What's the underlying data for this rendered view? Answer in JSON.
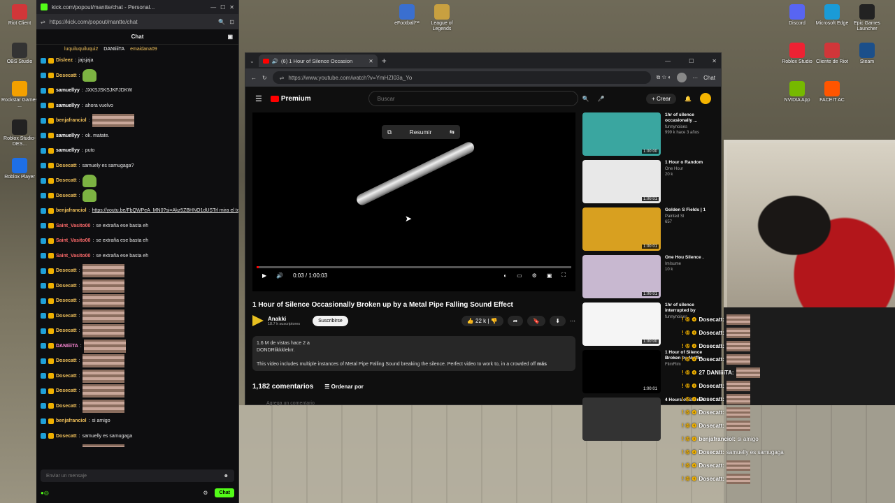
{
  "desktop": {
    "left_icons": [
      "Riot Client",
      "OBS Studio",
      "Rockstar Games ...",
      "Roblox Studio-DES...",
      "Roblox Player"
    ],
    "top_icons": [
      "eFootball™",
      "League of Legends"
    ],
    "right_icons": [
      {
        "label": "Discord",
        "color": "#5865f2"
      },
      {
        "label": "Microsoft Edge",
        "color": "#1a9bd7"
      },
      {
        "label": "Epic Games Launcher",
        "color": "#222222"
      },
      {
        "label": "Roblox Studio",
        "color": "#e23"
      },
      {
        "label": "Cliente de Riot",
        "color": "#d13639"
      },
      {
        "label": "Steam",
        "color": "#1b4f8a"
      },
      {
        "label": "NVIDIA App",
        "color": "#76b900"
      },
      {
        "label": "FACEIT AC",
        "color": "#ff5500"
      }
    ]
  },
  "chat_window": {
    "title": "kick.com/popout/mantte/chat - Personal...",
    "url": "https://kick.com/popout/mantte/chat",
    "header": "Chat",
    "pinned": [
      "luquiluquiluqui2",
      "DANIiiiTA",
      "emaidana09"
    ],
    "messages": [
      {
        "user": "Disleez",
        "text": "jajsjaja",
        "color": "#f0c05a"
      },
      {
        "user": "Dosecatt",
        "text": "",
        "color": "#f0c05a",
        "emote": "green"
      },
      {
        "user": "samuellyy",
        "text": "JXKSJSKSJKFJDKW",
        "color": "#ffffff"
      },
      {
        "user": "samuellyy",
        "text": "ahora vuelvo",
        "color": "#ffffff"
      },
      {
        "user": "benjafranciol",
        "text": "",
        "color": "#f0c05a",
        "emote": "img"
      },
      {
        "user": "samuellyy",
        "text": "ok. matate.",
        "color": "#ffffff"
      },
      {
        "user": "samuellyy",
        "text": "puto",
        "color": "#ffffff"
      },
      {
        "user": "Dosecatt",
        "text": "samuely es samugaga?",
        "color": "#f0c05a"
      },
      {
        "user": "Dosecatt",
        "text": "",
        "color": "#f0c05a",
        "emote": "green"
      },
      {
        "user": "Dosecatt",
        "text": "",
        "color": "#f0c05a",
        "emote": "green"
      },
      {
        "user": "benjafranciol",
        "text": "https://youtu.be/FbQWPeA_MN0?si=Akz5ZBHNO1dUSTrl mira el tema q saco cero asterisco",
        "color": "#f0c05a"
      },
      {
        "user": "Saint_Vasito00",
        "text": "se extraña ese basta eh",
        "color": "#ff6b6b"
      },
      {
        "user": "Saint_Vasito00",
        "text": "se extraña ese basta eh",
        "color": "#ff6b6b"
      },
      {
        "user": "Saint_Vasito00",
        "text": "se extraña ese basta eh",
        "color": "#ff6b6b"
      },
      {
        "user": "Dosecatt",
        "text": "",
        "color": "#f0c05a",
        "emote": "img"
      },
      {
        "user": "Dosecatt",
        "text": "",
        "color": "#f0c05a",
        "emote": "img"
      },
      {
        "user": "Dosecatt",
        "text": "",
        "color": "#f0c05a",
        "emote": "img"
      },
      {
        "user": "Dosecatt",
        "text": "",
        "color": "#f0c05a",
        "emote": "img"
      },
      {
        "user": "Dosecatt",
        "text": "",
        "color": "#f0c05a",
        "emote": "img"
      },
      {
        "user": "DANIiiiTA",
        "text": "",
        "color": "#ff8ad8",
        "emote": "img"
      },
      {
        "user": "Dosecatt",
        "text": "",
        "color": "#f0c05a",
        "emote": "img"
      },
      {
        "user": "Dosecatt",
        "text": "",
        "color": "#f0c05a",
        "emote": "img"
      },
      {
        "user": "Dosecatt",
        "text": "",
        "color": "#f0c05a",
        "emote": "img"
      },
      {
        "user": "Dosecatt",
        "text": "",
        "color": "#f0c05a",
        "emote": "img"
      },
      {
        "user": "benjafranciol",
        "text": "si amigo",
        "color": "#f0c05a"
      },
      {
        "user": "Dosecatt",
        "text": "samuelly es samugaga",
        "color": "#f0c05a"
      },
      {
        "user": "Dosecatt",
        "text": "",
        "color": "#f0c05a",
        "emote": "img"
      },
      {
        "user": "Dosecatt",
        "text": "",
        "color": "#f0c05a",
        "emote": "img"
      }
    ],
    "input_placeholder": "Enviar un mensaje",
    "chat_button": "Chat"
  },
  "browser": {
    "tab_title": "(6) 1 Hour of Silence Occasion",
    "url": "https://www.youtube.com/watch?v=YmHZI03a_Yo",
    "chat_label": "Chat",
    "yt": {
      "logo": "Premium",
      "search_placeholder": "Buscar",
      "create": "Crear",
      "resumir": "Resumir",
      "time": "0:03 / 1:00:03",
      "progress": 0.001,
      "video_title": "1 Hour of Silence Occasionally Broken up by a Metal Pipe Falling Sound Effect",
      "channel": "Anakki",
      "subscribers": "18.7 k suscriptores",
      "subscribe": "Suscribirse",
      "likes": "22 k",
      "views": "1.6 M de vistas  hace 2 a",
      "desc_tag": "DONDRlikkklekrr.",
      "description": "This video includes multiple instances of Metal Pipe Falling Sound breaking the silence. Perfect video to work to, in a crowded off",
      "more": "más",
      "comments_count": "1,182 comentarios",
      "sort": "Ordenar por",
      "add_comment": "Agrega un comentario"
    },
    "recommendations": [
      {
        "title": "1hr of silence occasionally ...",
        "channel": "funnynoises",
        "meta": "999 k  hace 3 años",
        "duration": "1:00:00",
        "thumb": "#3aa6a0"
      },
      {
        "title": "1 Hour o Random",
        "channel": "One Hour",
        "meta": "20 k",
        "duration": "1:00:01",
        "thumb": "#e8e8e8"
      },
      {
        "title": "Golden S Fields | 1",
        "channel": "Painted Sl",
        "meta": "657",
        "duration": "1:00:01",
        "thumb": "#d8a020"
      },
      {
        "title": "One Hou Silence .",
        "channel": "ImIsume",
        "meta": "10 k",
        "duration": "1:00:01",
        "thumb": "#c8b8d0"
      },
      {
        "title": "1hr of silence interrupted by",
        "channel": "funnynoises",
        "meta": "",
        "duration": "1:00:00",
        "thumb": "#f5f5f5"
      },
      {
        "title": "1 Hour of Silence Broken by Netflix",
        "channel": "FlimFlim",
        "meta": "",
        "duration": "1:00:01",
        "thumb": "#000000"
      },
      {
        "title": "4 Hours of Silence",
        "channel": "",
        "meta": "",
        "duration": "",
        "thumb": "#333333"
      }
    ]
  },
  "overlay_chat": [
    {
      "user": "Dosecatt:",
      "text": ""
    },
    {
      "user": "Dosecatt:",
      "text": ""
    },
    {
      "user": "Dosecatt:",
      "text": ""
    },
    {
      "user": "Dosecatt:",
      "text": ""
    },
    {
      "user": "27 DANIiiiTA:",
      "text": ""
    },
    {
      "user": "Dosecatt:",
      "text": ""
    },
    {
      "user": "Dosecatt:",
      "text": ""
    },
    {
      "user": "Dosecatt:",
      "text": ""
    },
    {
      "user": "Dosecatt:",
      "text": ""
    },
    {
      "user": "benjafranciol:",
      "text": "si amigo"
    },
    {
      "user": "Dosecatt:",
      "text": "samuelly es samugaga"
    },
    {
      "user": "Dosecatt:",
      "text": ""
    },
    {
      "user": "Dosecatt:",
      "text": ""
    }
  ]
}
